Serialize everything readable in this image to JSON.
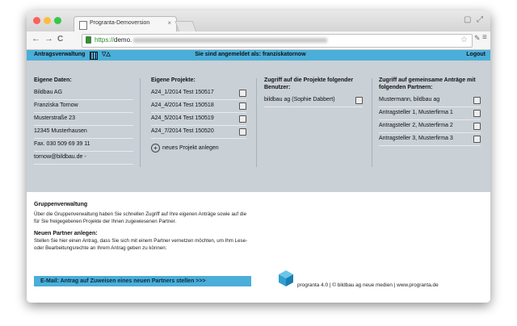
{
  "browser": {
    "tab_title": "Progranta-Demoversion",
    "tab_close": "×",
    "url_scheme": "https://",
    "url_host": "demo.",
    "nav_back": "←",
    "nav_forward": "→",
    "nav_reload": "C",
    "star": "☆",
    "window_buttons": [
      "●",
      "●",
      "●"
    ]
  },
  "appbar": {
    "title": "Antragsverwaltung",
    "logged_in": "Sie sind angemeldet als: franziskatornow",
    "logout": "Logout"
  },
  "own_data": {
    "title": "Eigene Daten:",
    "rows": [
      "Bildbau AG",
      "Franziska Tornow",
      "Musterstraße 23",
      "12345 Musterhausen",
      "Fax. 030 509 69 39 11",
      "tornow@bildbau.de -"
    ]
  },
  "own_projects": {
    "title": "Eigene Projekte:",
    "rows": [
      "A24_1/2014 Test 150517",
      "A24_4/2014 Test 150518",
      "A24_5/2014 Test 150519",
      "A24_7/2014 Test 150520"
    ],
    "new_project": "neues Projekt anlegen"
  },
  "access_projects": {
    "title": "Zugriff auf die Projekte folgender Benutzer:",
    "rows": [
      "bildbau ag (Sophie Dabbert)"
    ]
  },
  "shared_access": {
    "title": "Zugriff auf gemeinsame Anträge mit folgenden Partnern:",
    "rows": [
      "Mustermann, bildbau ag",
      "Antragsteller 1, Musterfirma 1",
      "Antragsteller 2, Musterfirma 2",
      "Antragsteller 3, Musterfirma 3"
    ]
  },
  "group": {
    "title": "Gruppenverwaltung",
    "text": "Über die Gruppenverwaltung haben Sie schnellen Zugriff auf Ihre eigenen Anträge sowie auf die für Sie freigegebenen Projekte der Ihnen zugewiesenen Partner.",
    "new_partner_title": "Neuen Partner anlegen:",
    "new_partner_text": "Stellen Sie hier einen Antrag, dass Sie sich mit einem Partner vernetzen möchten, um Ihm Lese- oder Bearbeitungsrechte an Ihrem Antrag geben zu können:",
    "mail_button": "E-Mail: Antrag auf Zuweisen eines neuen Partners stellen >>>"
  },
  "footer": {
    "text": "progranta 4.0 | © bildbau ag neue medien | www.progranta.de"
  },
  "colors": {
    "accent": "#4aaed9",
    "panel": "#c9d0d6"
  }
}
